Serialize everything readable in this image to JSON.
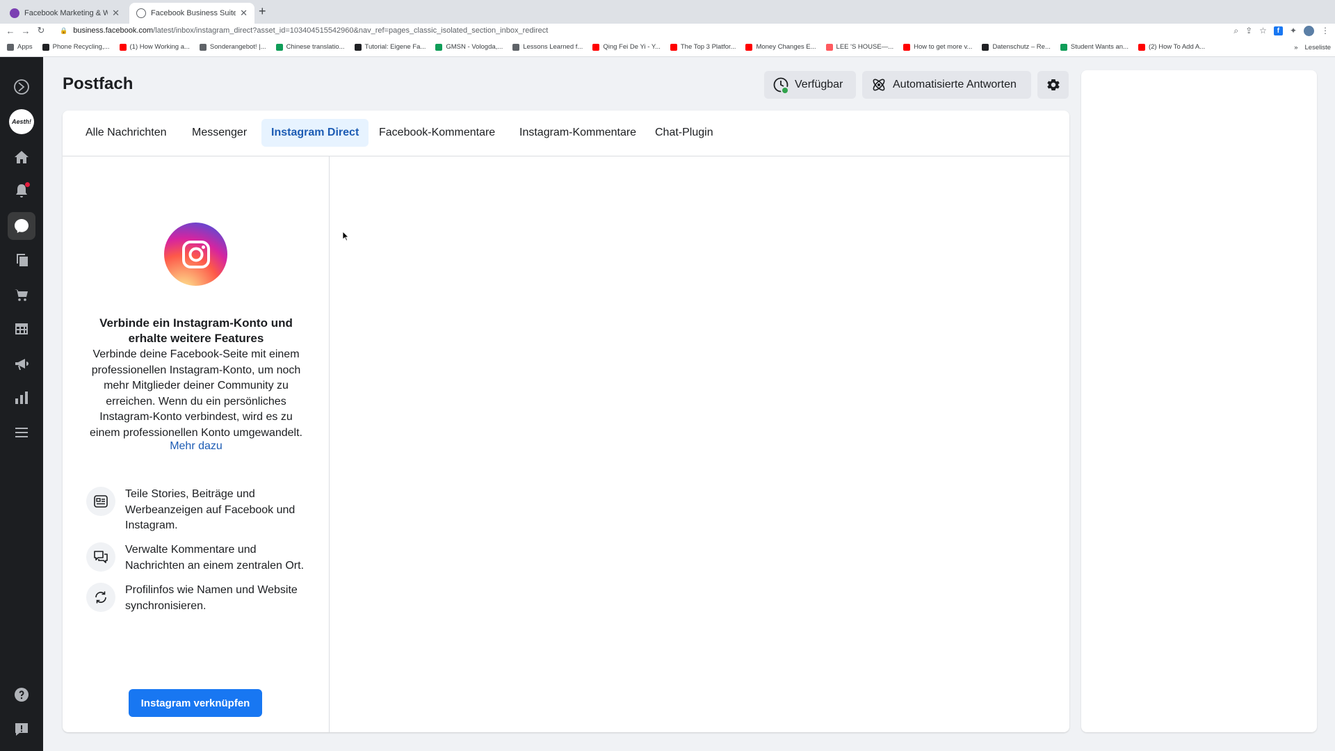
{
  "browser": {
    "tabs": [
      {
        "title": "Facebook Marketing & Werbea",
        "active": false,
        "favicon_color": "#7b3fb2"
      },
      {
        "title": "Facebook Business Suite",
        "active": true,
        "favicon_color": "#ffffff"
      }
    ],
    "new_tab": "+",
    "url_host": "business.facebook.com",
    "url_path": "/latest/inbox/instagram_direct?asset_id=103404515542960&nav_ref=pages_classic_isolated_section_inbox_redirect",
    "bookmarks": [
      {
        "label": "Apps",
        "color": "#5f6368"
      },
      {
        "label": "Phone Recycling,...",
        "color": "#202124"
      },
      {
        "label": "(1) How Working a...",
        "color": "#ff0000"
      },
      {
        "label": "Sonderangebot! |...",
        "color": "#5f6368"
      },
      {
        "label": "Chinese translatio...",
        "color": "#0f9d58"
      },
      {
        "label": "Tutorial: Eigene Fa...",
        "color": "#202124"
      },
      {
        "label": "GMSN - Vologda,...",
        "color": "#0f9d58"
      },
      {
        "label": "Lessons Learned f...",
        "color": "#5f6368"
      },
      {
        "label": "Qing Fei De Yi - Y...",
        "color": "#ff0000"
      },
      {
        "label": "The Top 3 Platfor...",
        "color": "#ff0000"
      },
      {
        "label": "Money Changes E...",
        "color": "#ff0000"
      },
      {
        "label": "LEE 'S HOUSE—...",
        "color": "#ff5a5f"
      },
      {
        "label": "How to get more v...",
        "color": "#ff0000"
      },
      {
        "label": "Datenschutz – Re...",
        "color": "#202124"
      },
      {
        "label": "Student Wants an...",
        "color": "#0f9d58"
      },
      {
        "label": "(2) How To Add A...",
        "color": "#ff0000"
      }
    ],
    "more_bookmarks": "»",
    "reading_list": "Leseliste"
  },
  "leftnav": {
    "avatar_text": "Aesth!"
  },
  "header": {
    "title": "Postfach",
    "available_label": "Verfügbar",
    "auto_replies_label": "Automatisierte Antworten"
  },
  "inbox_tabs": [
    {
      "label": "Alle Nachrichten",
      "active": false
    },
    {
      "label": "Messenger",
      "active": false
    },
    {
      "label": "Instagram Direct",
      "active": true
    },
    {
      "label": "Facebook-Kommentare",
      "active": false
    },
    {
      "label": "Instagram-Kommentare",
      "active": false
    },
    {
      "label": "Chat-Plugin",
      "active": false
    }
  ],
  "connect_panel": {
    "title": "Verbinde ein Instagram-Konto und erhalte weitere Features",
    "description": "Verbinde deine Facebook-Seite mit einem professionellen Instagram-Konto, um noch mehr Mitglieder deiner Community zu erreichen. Wenn du ein persönliches Instagram-Konto verbindest, wird es zu einem professionellen Konto umgewandelt.",
    "more_link": "Mehr dazu",
    "features": [
      {
        "icon": "post-icon",
        "text": "Teile Stories, Beiträge und Werbeanzeigen auf Facebook und Instagram."
      },
      {
        "icon": "chat-bubbles-icon",
        "text": "Verwalte Kommentare und Nachrichten an einem zentralen Ort."
      },
      {
        "icon": "sync-icon",
        "text": "Profilinfos wie Namen und Website synchronisieren."
      }
    ],
    "connect_button": "Instagram verknüpfen"
  },
  "colors": {
    "brand_blue": "#1877f2",
    "active_tab_text": "#1d5cb4",
    "status_available": "#31a24c"
  }
}
